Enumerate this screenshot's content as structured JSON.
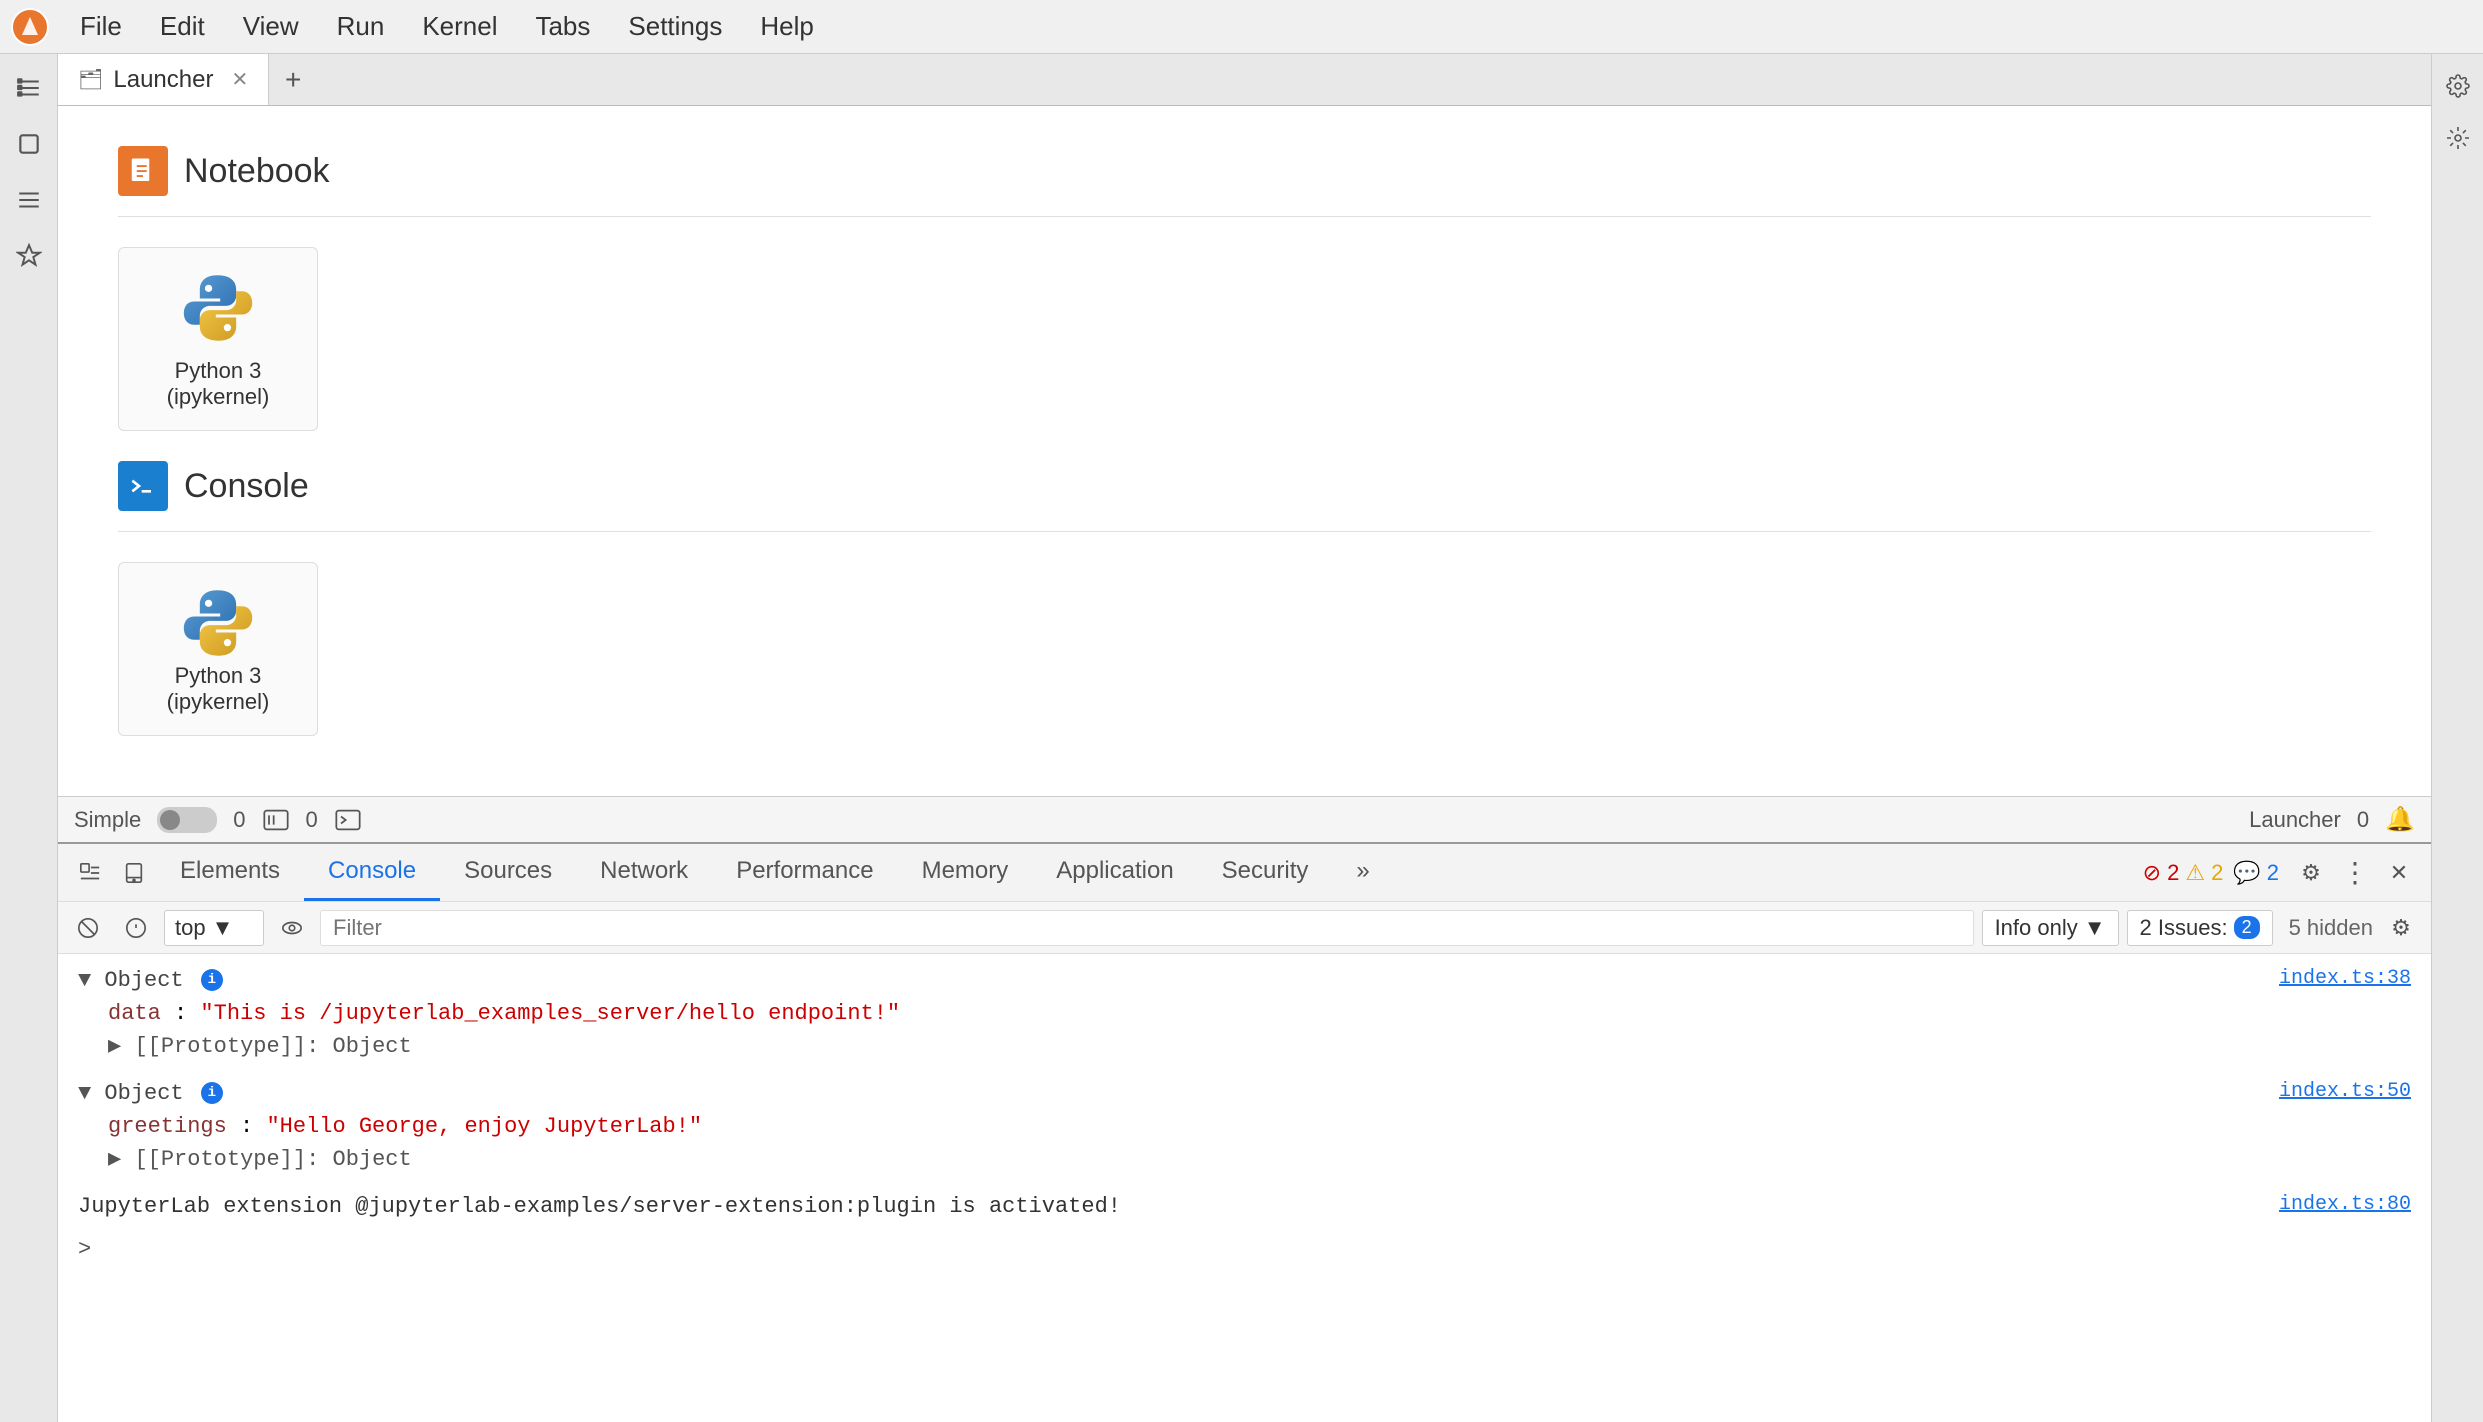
{
  "menubar": {
    "items": [
      "File",
      "Edit",
      "View",
      "Run",
      "Kernel",
      "Tabs",
      "Settings",
      "Help"
    ]
  },
  "sidebar": {
    "icons": [
      {
        "name": "folder-icon",
        "symbol": "📁"
      },
      {
        "name": "stop-icon",
        "symbol": "⏹"
      },
      {
        "name": "list-icon",
        "symbol": "☰"
      },
      {
        "name": "puzzle-icon",
        "symbol": "🧩"
      }
    ]
  },
  "tabs": [
    {
      "label": "Launcher",
      "icon": "🗂",
      "active": true
    }
  ],
  "tab_add_label": "+",
  "launcher": {
    "sections": [
      {
        "name": "Notebook",
        "icon_type": "notebook",
        "icon_char": "📓",
        "kernels": [
          {
            "name": "Python 3 (ipykernel)",
            "logo_type": "python"
          }
        ]
      },
      {
        "name": "Console",
        "icon_type": "console",
        "icon_char": ">_",
        "kernels": [
          {
            "name": "Python 3 (ipykernel)",
            "logo_type": "python"
          }
        ]
      }
    ]
  },
  "statusbar": {
    "simple_label": "Simple",
    "num1": "0",
    "num2": "0",
    "launcher_label": "Launcher",
    "notif_count": "0"
  },
  "devtools": {
    "tabs": [
      "Elements",
      "Console",
      "Sources",
      "Network",
      "Performance",
      "Memory",
      "Application",
      "Security"
    ],
    "active_tab": "Console",
    "more_label": "»",
    "error_count": "2",
    "warn_count": "2",
    "msg_count": "2",
    "close_label": "✕"
  },
  "console_toolbar": {
    "top_label": "top",
    "filter_placeholder": "Filter",
    "info_only_label": "Info only",
    "issues_label": "2 Issues:",
    "issues_count": "2",
    "hidden_label": "5 hidden"
  },
  "console_output": {
    "entries": [
      {
        "type": "object",
        "label": "Object",
        "link": "index.ts:38",
        "properties": [
          {
            "key": "data",
            "value": "\"This is /jupyterlab_examples_server/hello endpoint!\""
          }
        ],
        "proto": "[[Prototype]]: Object"
      },
      {
        "type": "object",
        "label": "Object",
        "link": "index.ts:50",
        "properties": [
          {
            "key": "greetings",
            "value": "\"Hello George, enjoy JupyterLab!\""
          }
        ],
        "proto": "[[Prototype]]: Object"
      }
    ],
    "log_line": "JupyterLab extension @jupyterlab-examples/server-extension:plugin is activated!",
    "log_link": "index.ts:80",
    "prompt": ">"
  }
}
